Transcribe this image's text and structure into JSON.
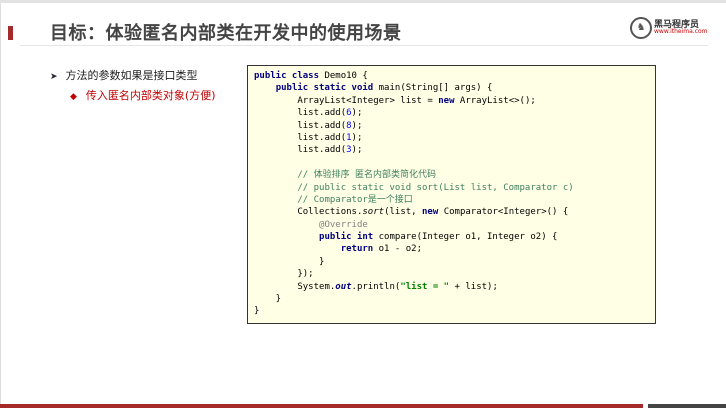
{
  "slide": {
    "title": "目标：体验匿名内部类在开发中的使用场景",
    "logo": {
      "name": "黑马程序员",
      "url": "www.itheima.com"
    },
    "bullets": [
      {
        "marker": "➤",
        "text": "方法的参数如果是接口类型"
      },
      {
        "marker": "◆",
        "text": "传入匿名内部类对象(方便)"
      }
    ],
    "colors": {
      "accent": "#a52a2a",
      "code_bg": "#ffffe6",
      "bullet2": "#c00000"
    }
  },
  "code": [
    [
      [
        "kw",
        "public class "
      ],
      [
        "",
        "Demo10 {"
      ]
    ],
    [
      [
        "",
        "    "
      ],
      [
        "kw",
        "public static void "
      ],
      [
        "",
        "main(String[] args) {"
      ]
    ],
    [
      [
        "",
        "        ArrayList<Integer> list = "
      ],
      [
        "kw",
        "new "
      ],
      [
        "",
        "ArrayList<>();"
      ]
    ],
    [
      [
        "",
        "        list.add("
      ],
      [
        "num",
        "6"
      ],
      [
        "",
        ");"
      ]
    ],
    [
      [
        "",
        "        list.add("
      ],
      [
        "num",
        "8"
      ],
      [
        "",
        ");"
      ]
    ],
    [
      [
        "",
        "        list.add("
      ],
      [
        "num",
        "1"
      ],
      [
        "",
        ");"
      ]
    ],
    [
      [
        "",
        "        list.add("
      ],
      [
        "num",
        "3"
      ],
      [
        "",
        ");"
      ]
    ],
    [
      [
        "",
        ""
      ]
    ],
    [
      [
        "cm",
        "        // 体验排序 匿名内部类简化代码"
      ]
    ],
    [
      [
        "cm",
        "        // public static void sort(List list, Comparator c)"
      ]
    ],
    [
      [
        "cm",
        "        // Comparator是一个接口"
      ]
    ],
    [
      [
        "",
        "        Collections."
      ],
      [
        "it",
        "sort"
      ],
      [
        "",
        "(list, "
      ],
      [
        "kw",
        "new "
      ],
      [
        "",
        "Comparator<Integer>() {"
      ]
    ],
    [
      [
        "an",
        "            @Override"
      ]
    ],
    [
      [
        "",
        "            "
      ],
      [
        "kw",
        "public int "
      ],
      [
        "",
        "compare(Integer o1, Integer o2) {"
      ]
    ],
    [
      [
        "",
        "                "
      ],
      [
        "kw",
        "return "
      ],
      [
        "",
        "o1 - o2;"
      ]
    ],
    [
      [
        "",
        "            }"
      ]
    ],
    [
      [
        "",
        "        });"
      ]
    ],
    [
      [
        "",
        "        System."
      ],
      [
        "itb",
        "out"
      ],
      [
        "",
        ".println("
      ],
      [
        "st",
        "\"list = \""
      ],
      [
        "",
        ""
      ],
      [
        "",
        " + list);"
      ]
    ],
    [
      [
        "",
        "    }"
      ]
    ],
    [
      [
        "",
        "}"
      ]
    ]
  ]
}
